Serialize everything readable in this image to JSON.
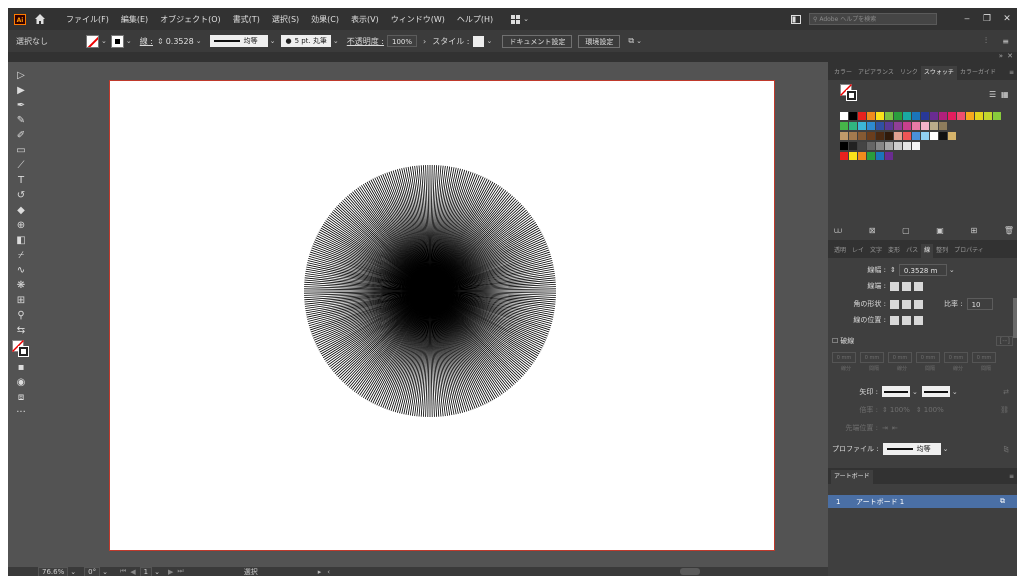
{
  "menu": {
    "logo": "Ai",
    "items": [
      "ファイル(F)",
      "編集(E)",
      "オブジェクト(O)",
      "書式(T)",
      "選択(S)",
      "効果(C)",
      "表示(V)",
      "ウィンドウ(W)",
      "ヘルプ(H)"
    ],
    "search_placeholder": "Adobe ヘルプを検索",
    "win_buttons": [
      "‒",
      "❐",
      "✕"
    ]
  },
  "control": {
    "selection": "選択なし",
    "stroke_label": "線 :",
    "stroke_value": "0.3528",
    "profile": "均等",
    "brush": "5 pt. 丸筆",
    "opacity_label": "不透明度 :",
    "opacity_value": "100%",
    "style_label": "スタイル :",
    "doc_setup": "ドキュメント設定",
    "prefs": "環境設定"
  },
  "status": {
    "zoom": "76.6%",
    "rotation": "0°",
    "artboard_num": "1",
    "mode": "選択"
  },
  "panels": {
    "top_tabs": [
      "カラー",
      "アピアランス",
      "リンク",
      "スウォッチ",
      "カラーガイド"
    ],
    "mid_tabs": [
      "透明",
      "レイ",
      "文字",
      "変形",
      "パス",
      "線",
      "整列",
      "プロパティ"
    ],
    "stroke": {
      "weight_label": "線幅 :",
      "weight_value": "0.3528 m",
      "cap_label": "線端 :",
      "corner_label": "角の形状 :",
      "limit_label": "比率 :",
      "limit_value": "10",
      "align_label": "線の位置 :",
      "dashed_label": "破線",
      "dash_cells": [
        "0 mm",
        "0 mm",
        "0 mm",
        "0 mm",
        "0 mm",
        "0 mm"
      ],
      "dash_sublabels": [
        "線分",
        "間隔",
        "線分",
        "間隔",
        "線分",
        "間隔"
      ],
      "arrow_label": "矢印 :",
      "scale_label": "倍率 :",
      "scale_values": [
        "100%",
        "100%"
      ],
      "align_arrow_label": "先端位置 :",
      "profile_label": "プロファイル :",
      "profile_value": "均等"
    },
    "artboards": {
      "tab": "アートボード",
      "rows": [
        {
          "num": "1",
          "name": "アートボード 1"
        }
      ]
    }
  },
  "swatch_colors": [
    "#ffffff",
    "#000000",
    "#e8211e",
    "#f08b1d",
    "#fbe21a",
    "#7bc043",
    "#2a9d3d",
    "#19a9a1",
    "#1b75bb",
    "#283897",
    "#6a2c91",
    "#b0207c",
    "#e51d5e",
    "#ef4f6f",
    "#f7a81d",
    "#e4d41d",
    "#c3d72d",
    "#88cb3c",
    "#46b649",
    "#30b580",
    "#3cb6d7",
    "#2e8ad0",
    "#3050a3",
    "#5a3a96",
    "#903e98",
    "#c83f8d",
    "#e87aa6",
    "#f4b2c9",
    "#b9ac8a",
    "#8d7c5c",
    "#bf9a6a",
    "#a27a4e",
    "#855a33",
    "#6b3e1d",
    "#4b2a12",
    "#2f1a0a",
    "#e0a090",
    "#e55",
    "#4a90d9",
    "#90d0f0",
    "#ffffff",
    "#111111",
    "#d5b36b",
    "#000000",
    "#222222",
    "#444444",
    "#666666",
    "#888888",
    "#aaaaaa",
    "#cccccc",
    "#e6e6e6",
    "#f5f5f5",
    "#e8211e",
    "#fbe21a",
    "#f08b1d",
    "#2a9d3d",
    "#1b75bb",
    "#6a2c91"
  ]
}
